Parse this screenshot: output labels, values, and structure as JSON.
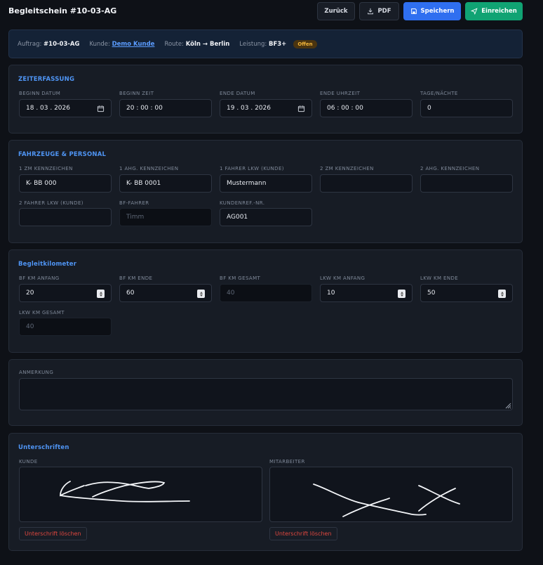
{
  "header": {
    "title": "Begleitschein #10-03-AG",
    "back_label": "Zurück",
    "pdf_label": "PDF",
    "save_label": "Speichern",
    "submit_label": "Einreichen"
  },
  "info": {
    "order_label": "Auftrag:",
    "order_value": "#10-03-AG",
    "customer_label": "Kunde:",
    "customer_value": "Demo Kunde",
    "route_label": "Route:",
    "route_value": "Köln → Berlin",
    "service_label": "Leistung:",
    "service_value": "BF3+",
    "status": "Offen"
  },
  "time": {
    "title": "ZEITERFASSUNG",
    "fields": [
      {
        "label": "BEGINN DATUM",
        "value": "18 . 03 . 2026"
      },
      {
        "label": "BEGINN ZEIT",
        "value": "20 : 00 : 00"
      },
      {
        "label": "ENDE DATUM",
        "value": "19 . 03 . 2026"
      },
      {
        "label": "ENDE UHRZEIT",
        "value": "06 : 00 : 00"
      },
      {
        "label": "TAGE/NÄCHTE",
        "value": "0"
      }
    ]
  },
  "vehicles": {
    "title": "FAHRZEUGE & PERSONAL",
    "fields": [
      {
        "label": "1 ZM KENNZEICHEN",
        "value": "K- BB 000"
      },
      {
        "label": "1 AHG. KENNZEICHEN",
        "value": "K- BB 0001"
      },
      {
        "label": "1 FAHRER LKW (KUNDE)",
        "value": "Mustermann"
      },
      {
        "label": "2 ZM KENNZEICHEN",
        "value": ""
      },
      {
        "label": "2 AHG. KENNZEICHEN",
        "value": ""
      },
      {
        "label": "2 FAHRER LKW (KUNDE)",
        "value": ""
      },
      {
        "label": "BF-FAHRER",
        "value": "Timm"
      },
      {
        "label": "KUNDENREF.-NR.",
        "value": "AG001"
      }
    ]
  },
  "km": {
    "title": "Begleitkilometer",
    "fields": [
      {
        "label": "BF KM ANFANG",
        "value": "20"
      },
      {
        "label": "BF KM ENDE",
        "value": "60"
      },
      {
        "label": "BF KM GESAMT",
        "value": "40"
      },
      {
        "label": "LKW KM ANFANG",
        "value": "10"
      },
      {
        "label": "LKW KM ENDE",
        "value": "50"
      },
      {
        "label": "LKW KM GESAMT",
        "value": "40"
      }
    ]
  },
  "notes": {
    "label": "ANMERKUNG",
    "value": ""
  },
  "signatures": {
    "title": "Unterschriften",
    "customer_label": "KUNDE",
    "employee_label": "MITARBEITER",
    "clear_label": "Unterschrift löschen"
  },
  "icons": [
    "arrow-left-icon",
    "download-icon",
    "save-icon",
    "send-icon",
    "calendar-icon",
    "spinner-icon",
    "resize-handle-icon"
  ],
  "colors": {
    "background": "#0e1117",
    "card": "#171c25",
    "accent_blue": "#2f6ff0",
    "accent_green": "#10a373",
    "section_title": "#4f95f5",
    "danger": "#e0473f",
    "badge": "#f0b43a"
  }
}
